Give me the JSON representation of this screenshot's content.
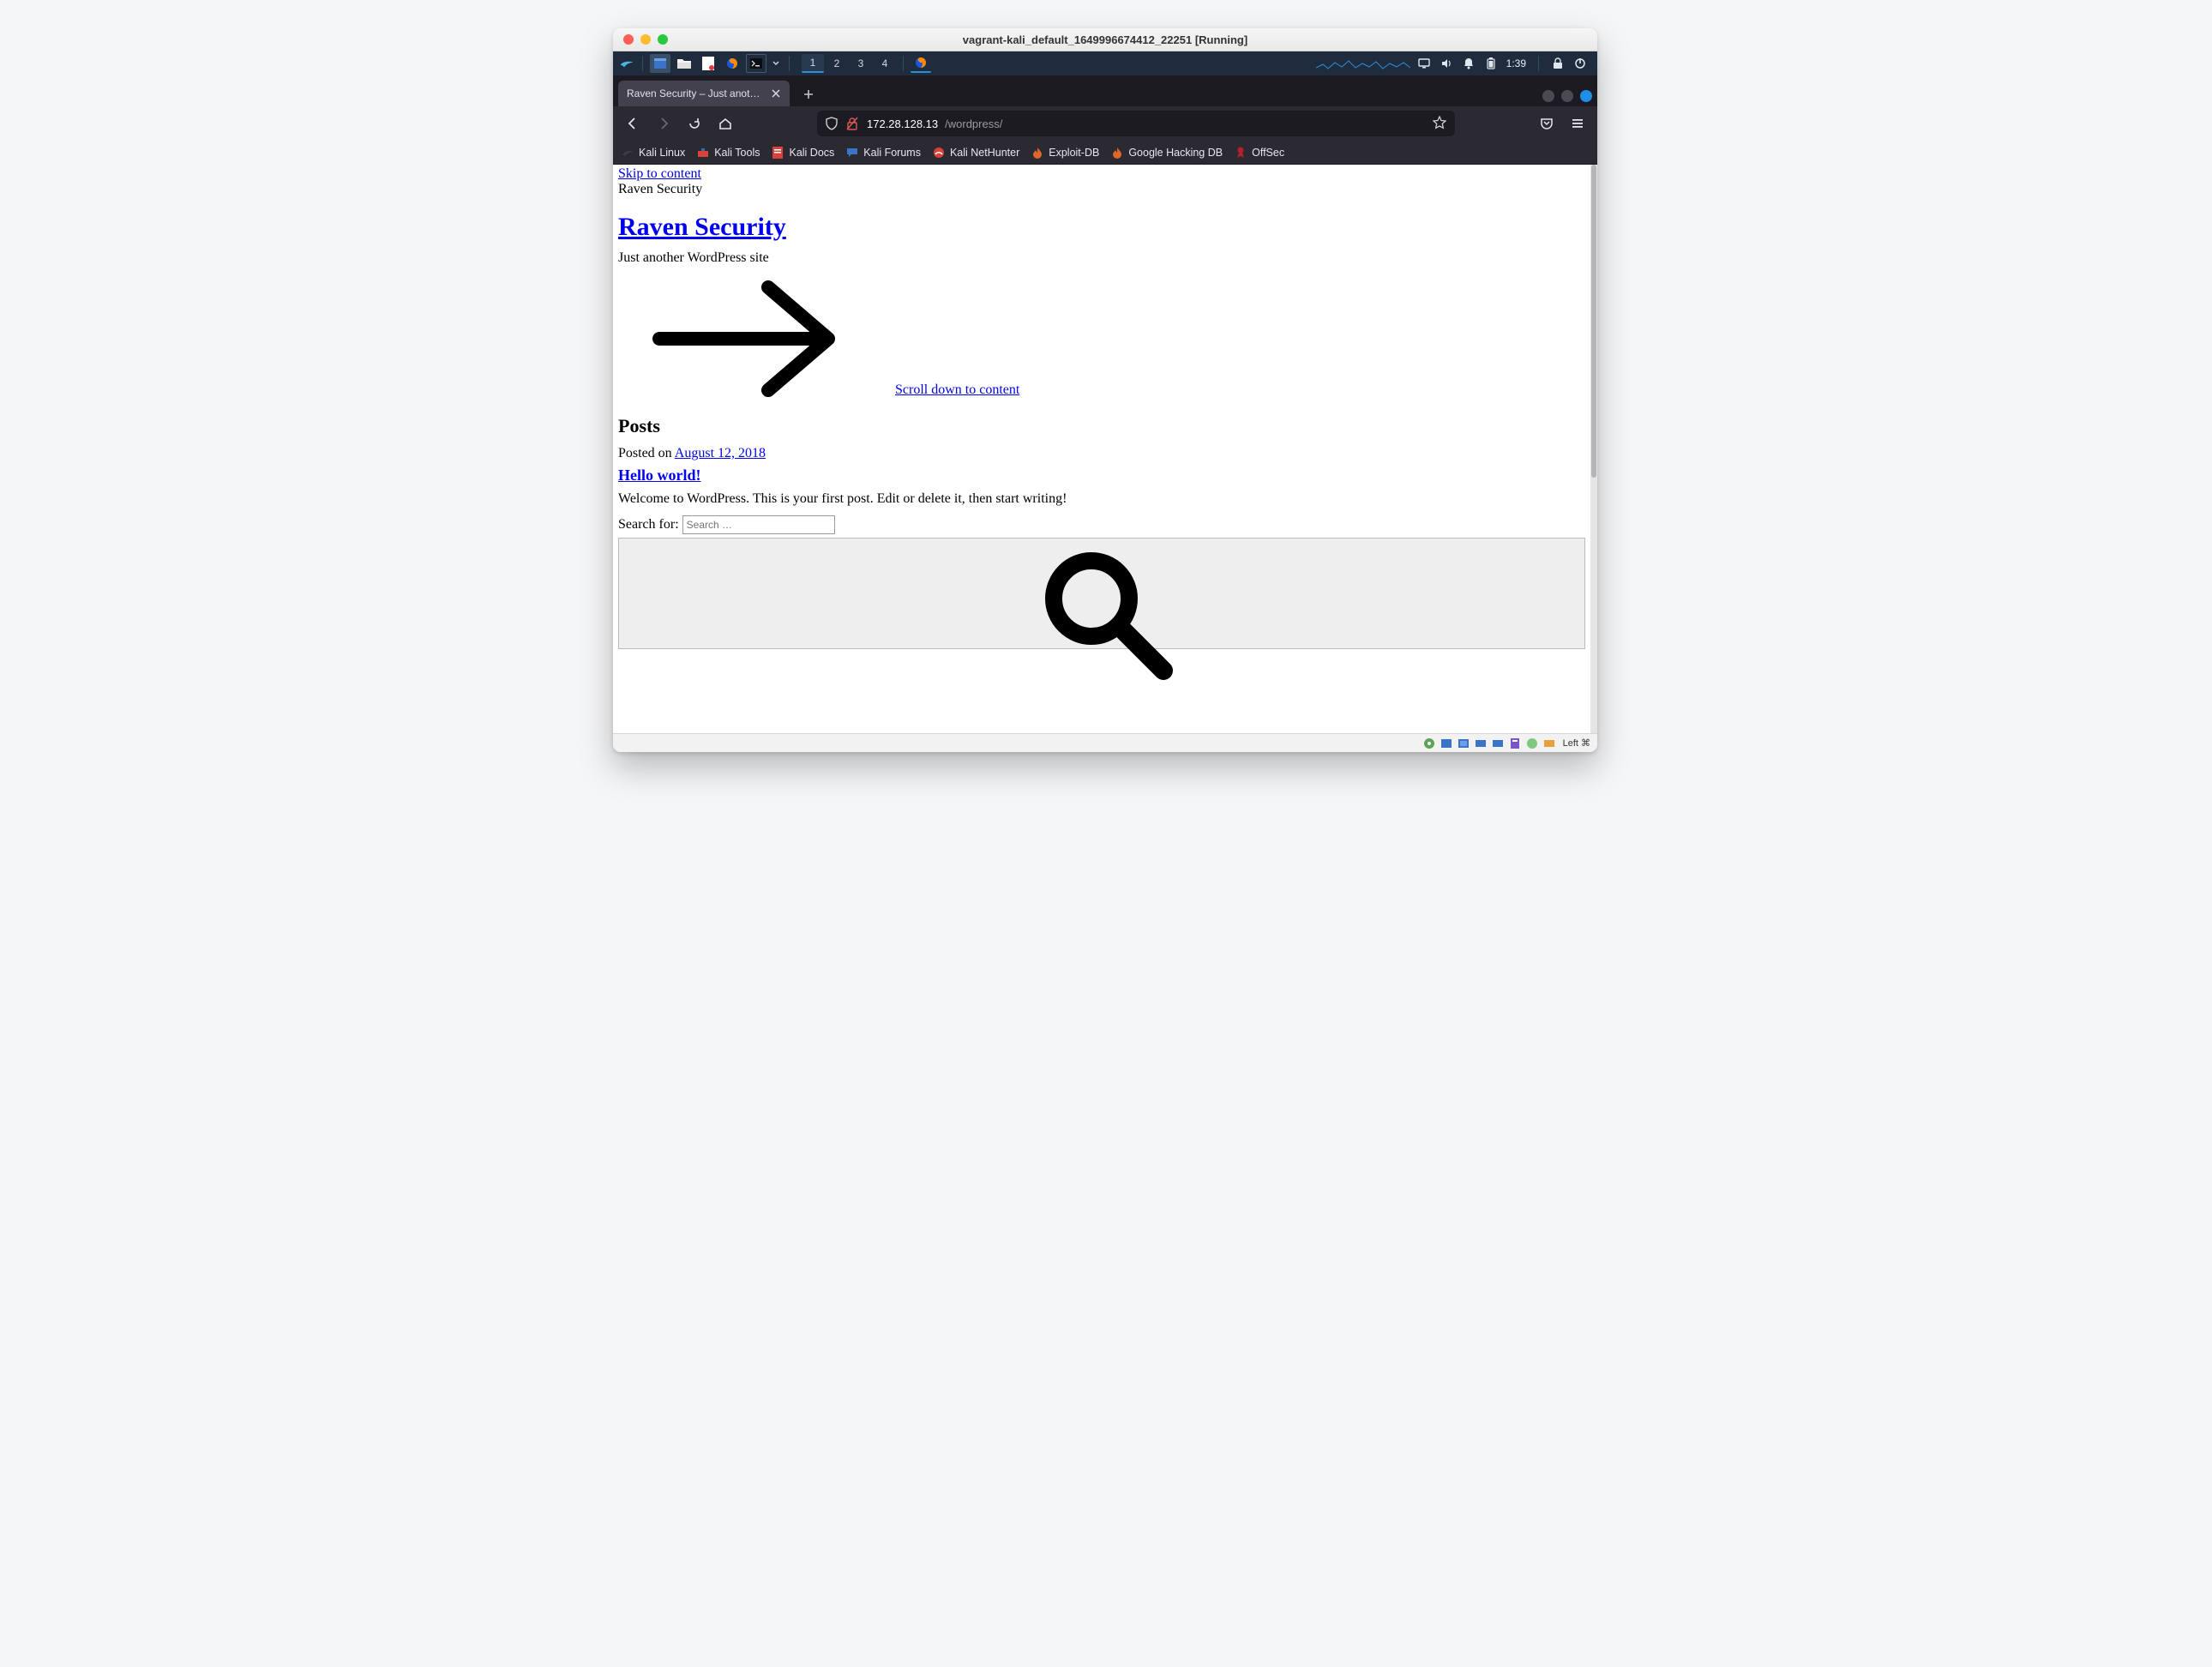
{
  "mac": {
    "title": "vagrant-kali_default_1649996674412_22251 [Running]"
  },
  "panel": {
    "workspaces": [
      "1",
      "2",
      "3",
      "4"
    ],
    "active_workspace": 0,
    "clock": "1:39"
  },
  "firefox": {
    "tab_title": "Raven Security – Just another",
    "url_host": "172.28.128.13",
    "url_path": "/wordpress/",
    "bookmarks": [
      {
        "label": "Kali Linux",
        "icon": "dragon"
      },
      {
        "label": "Kali Tools",
        "icon": "toolbox"
      },
      {
        "label": "Kali Docs",
        "icon": "doc"
      },
      {
        "label": "Kali Forums",
        "icon": "chat"
      },
      {
        "label": "Kali NetHunter",
        "icon": "nethunter"
      },
      {
        "label": "Exploit-DB",
        "icon": "flame"
      },
      {
        "label": "Google Hacking DB",
        "icon": "flame"
      },
      {
        "label": "OffSec",
        "icon": "ribbon"
      }
    ]
  },
  "page": {
    "skip": "Skip to content",
    "site_name_top": "Raven Security",
    "site_title": "Raven Security",
    "tagline": "Just another WordPress site",
    "scroll_link": "Scroll down to content",
    "posts_heading": "Posts",
    "posted_on_label": "Posted on ",
    "post_date": "August 12, 2018",
    "post_title": "Hello world!",
    "excerpt": "Welcome to WordPress. This is your first post. Edit or delete it, then start writing!",
    "search_label": "Search for:",
    "search_placeholder": "Search …"
  },
  "vbox": {
    "hostkey": "Left ⌘"
  }
}
